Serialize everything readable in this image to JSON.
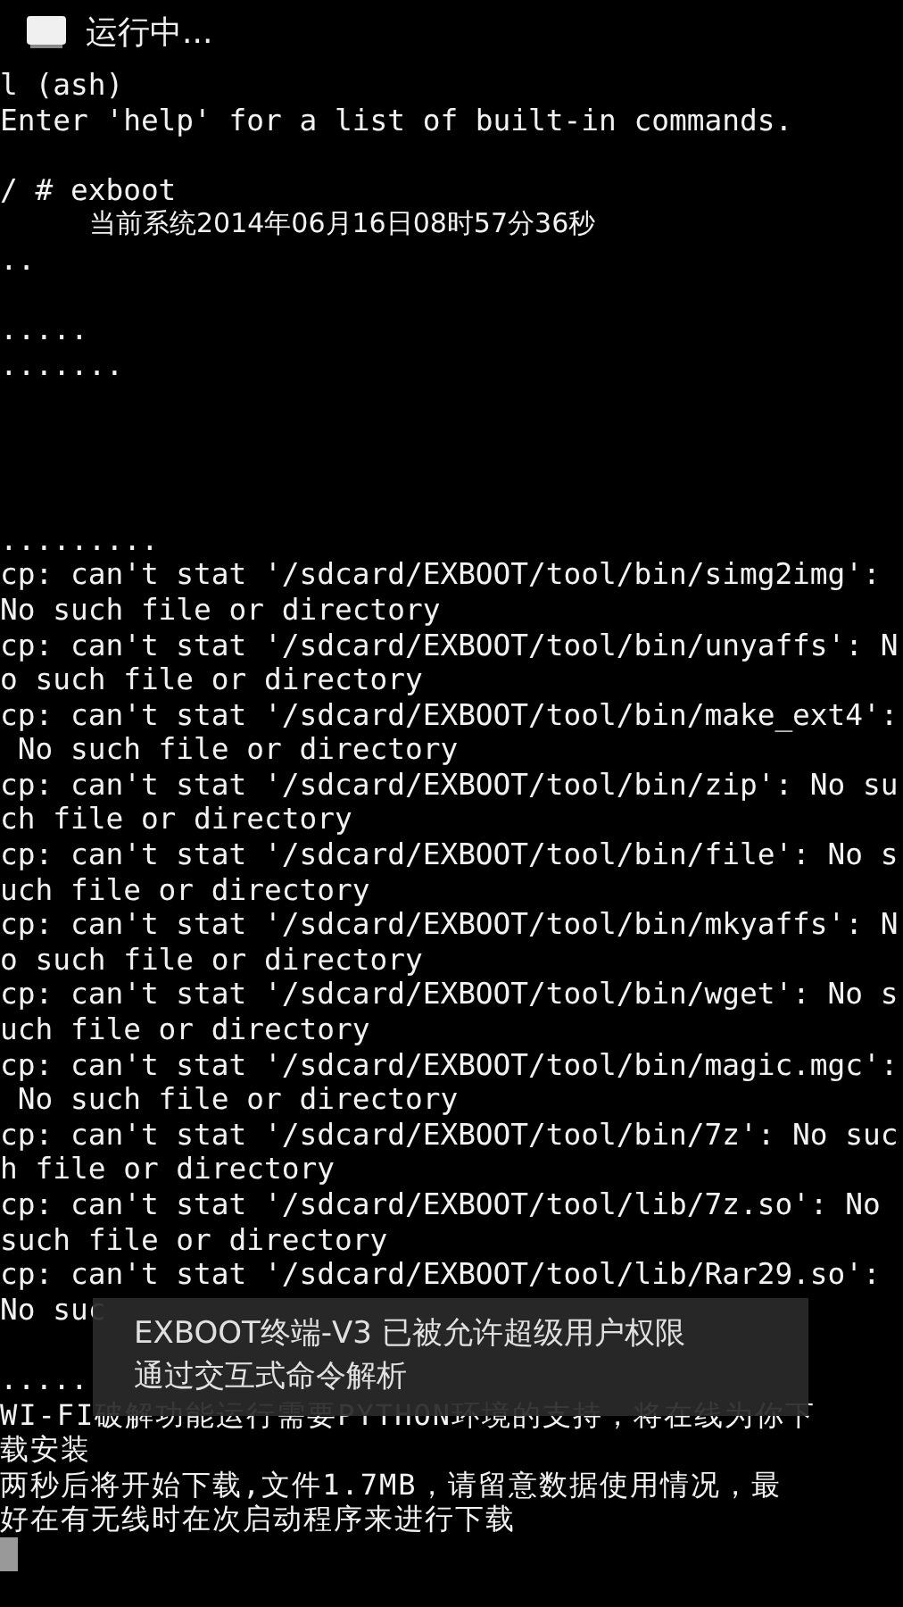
{
  "title_bar": {
    "title": "运行中..."
  },
  "terminal": {
    "lines": [
      {
        "kind": "text",
        "text": "l (ash)"
      },
      {
        "kind": "text",
        "text": "Enter 'help' for a list of built-in commands."
      },
      {
        "kind": "blank"
      },
      {
        "kind": "text",
        "text": "/ # exboot"
      },
      {
        "kind": "indented",
        "text": "当前系统2014年06月16日08时57分36秒"
      },
      {
        "kind": "text",
        "text": ".."
      },
      {
        "kind": "blank"
      },
      {
        "kind": "text",
        "text": "....."
      },
      {
        "kind": "text",
        "text": "......."
      },
      {
        "kind": "blank"
      },
      {
        "kind": "blank"
      },
      {
        "kind": "blank"
      },
      {
        "kind": "blank"
      },
      {
        "kind": "text",
        "text": "........."
      },
      {
        "kind": "text",
        "text": "cp: can't stat '/sdcard/EXBOOT/tool/bin/simg2img':"
      },
      {
        "kind": "text",
        "text": "No such file or directory"
      },
      {
        "kind": "text",
        "text": "cp: can't stat '/sdcard/EXBOOT/tool/bin/unyaffs': N"
      },
      {
        "kind": "text",
        "text": "o such file or directory"
      },
      {
        "kind": "text",
        "text": "cp: can't stat '/sdcard/EXBOOT/tool/bin/make_ext4':"
      },
      {
        "kind": "text",
        "text": " No such file or directory"
      },
      {
        "kind": "text",
        "text": "cp: can't stat '/sdcard/EXBOOT/tool/bin/zip': No su"
      },
      {
        "kind": "text",
        "text": "ch file or directory"
      },
      {
        "kind": "text",
        "text": "cp: can't stat '/sdcard/EXBOOT/tool/bin/file': No s"
      },
      {
        "kind": "text",
        "text": "uch file or directory"
      },
      {
        "kind": "text",
        "text": "cp: can't stat '/sdcard/EXBOOT/tool/bin/mkyaffs': N"
      },
      {
        "kind": "text",
        "text": "o such file or directory"
      },
      {
        "kind": "text",
        "text": "cp: can't stat '/sdcard/EXBOOT/tool/bin/wget': No s"
      },
      {
        "kind": "text",
        "text": "uch file or directory"
      },
      {
        "kind": "text",
        "text": "cp: can't stat '/sdcard/EXBOOT/tool/bin/magic.mgc':"
      },
      {
        "kind": "text",
        "text": " No such file or directory"
      },
      {
        "kind": "text",
        "text": "cp: can't stat '/sdcard/EXBOOT/tool/bin/7z': No suc"
      },
      {
        "kind": "text",
        "text": "h file or directory"
      },
      {
        "kind": "text",
        "text": "cp: can't stat '/sdcard/EXBOOT/tool/lib/7z.so': No "
      },
      {
        "kind": "text",
        "text": "such file or directory"
      },
      {
        "kind": "text",
        "text": "cp: can't stat '/sdcard/EXBOOT/tool/lib/Rar29.so':"
      },
      {
        "kind": "text",
        "text": "No suc"
      },
      {
        "kind": "blank"
      },
      {
        "kind": "text",
        "text": "....."
      },
      {
        "kind": "cjk",
        "text": "WI-FI破解功能运行需要PYTHON环境的支持，将在线为你下"
      },
      {
        "kind": "cjk",
        "text": "载安装"
      },
      {
        "kind": "cjk",
        "text": "两秒后将开始下载,文件1.7MB，请留意数据使用情况，最"
      },
      {
        "kind": "cjk",
        "text": "好在有无线时在次启动程序来进行下载"
      },
      {
        "kind": "cursor"
      }
    ]
  },
  "toast": {
    "lines": [
      "EXBOOT终端-V3 已被允许超级用户权限",
      "通过交互式命令解析"
    ]
  }
}
